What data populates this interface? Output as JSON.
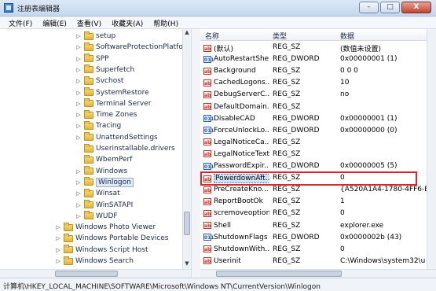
{
  "title": "注册表编辑器",
  "window_buttons": {
    "minimize": "–",
    "maximize": "□",
    "close": "X"
  },
  "menu": [
    "文件(F)",
    "编辑(E)",
    "查看(V)",
    "收藏夹(A)",
    "帮助(H)"
  ],
  "tree": {
    "items": [
      {
        "label": "setup",
        "expander": "▷",
        "indent": 2
      },
      {
        "label": "SoftwareProtectionPlatform",
        "expander": "▷",
        "indent": 2
      },
      {
        "label": "SPP",
        "expander": "▷",
        "indent": 2
      },
      {
        "label": "Superfetch",
        "expander": "▷",
        "indent": 2
      },
      {
        "label": "Svchost",
        "expander": "▷",
        "indent": 2
      },
      {
        "label": "SystemRestore",
        "expander": "▷",
        "indent": 2
      },
      {
        "label": "Terminal Server",
        "expander": "▷",
        "indent": 2
      },
      {
        "label": "Time Zones",
        "expander": "▷",
        "indent": 2
      },
      {
        "label": "Tracing",
        "expander": "▷",
        "indent": 2
      },
      {
        "label": "UnattendSettings",
        "expander": "▷",
        "indent": 2
      },
      {
        "label": "Userinstallable.drivers",
        "expander": "",
        "indent": 2
      },
      {
        "label": "WbemPerf",
        "expander": "",
        "indent": 2
      },
      {
        "label": "Windows",
        "expander": "▷",
        "indent": 2
      },
      {
        "label": "Winlogon",
        "expander": "▷",
        "indent": 2,
        "selected": true
      },
      {
        "label": "Winsat",
        "expander": "▷",
        "indent": 2
      },
      {
        "label": "WinSATAPI",
        "expander": "▷",
        "indent": 2
      },
      {
        "label": "WUDF",
        "expander": "▷",
        "indent": 2
      },
      {
        "label": "Windows Photo Viewer",
        "expander": "▷",
        "indent": 1
      },
      {
        "label": "Windows Portable Devices",
        "expander": "▷",
        "indent": 1
      },
      {
        "label": "Windows Script Host",
        "expander": "▷",
        "indent": 1
      },
      {
        "label": "Windows Search",
        "expander": "▷",
        "indent": 1
      }
    ]
  },
  "values": {
    "headers": {
      "name": "名称",
      "type": "类型",
      "data": "数据"
    },
    "rows": [
      {
        "icon": "sz",
        "name": "(默认)",
        "type": "REG_SZ",
        "data": "(数值未设置)"
      },
      {
        "icon": "dword",
        "name": "AutoRestartShell",
        "type": "REG_DWORD",
        "data": "0x00000001 (1)"
      },
      {
        "icon": "sz",
        "name": "Background",
        "type": "REG_SZ",
        "data": "0 0 0"
      },
      {
        "icon": "sz",
        "name": "CachedLogons...",
        "type": "REG_SZ",
        "data": "10"
      },
      {
        "icon": "sz",
        "name": "DebugServerC...",
        "type": "REG_SZ",
        "data": "no"
      },
      {
        "icon": "sz",
        "name": "DefaultDomain...",
        "type": "REG_SZ",
        "data": ""
      },
      {
        "icon": "dword",
        "name": "DisableCAD",
        "type": "REG_DWORD",
        "data": "0x00000001 (1)"
      },
      {
        "icon": "dword",
        "name": "ForceUnlockLo...",
        "type": "REG_DWORD",
        "data": "0x00000000 (0)"
      },
      {
        "icon": "sz",
        "name": "LegalNoticeCa...",
        "type": "REG_SZ",
        "data": ""
      },
      {
        "icon": "sz",
        "name": "LegalNoticeText",
        "type": "REG_SZ",
        "data": ""
      },
      {
        "icon": "dword",
        "name": "PasswordExpir...",
        "type": "REG_DWORD",
        "data": "0x00000005 (5)"
      },
      {
        "icon": "sz",
        "name": "PowerdownAft...",
        "type": "REG_SZ",
        "data": "0",
        "selected": true
      },
      {
        "icon": "sz",
        "name": "PreCreateKno...",
        "type": "REG_SZ",
        "data": "{A520A1A4-1780-4FF6-E"
      },
      {
        "icon": "sz",
        "name": "ReportBootOk",
        "type": "REG_SZ",
        "data": "1"
      },
      {
        "icon": "sz",
        "name": "scremoveoption",
        "type": "REG_SZ",
        "data": "0"
      },
      {
        "icon": "sz",
        "name": "Shell",
        "type": "REG_SZ",
        "data": "explorer.exe"
      },
      {
        "icon": "dword",
        "name": "ShutdownFlags",
        "type": "REG_DWORD",
        "data": "0x0000002b (43)"
      },
      {
        "icon": "sz",
        "name": "ShutdownWith...",
        "type": "REG_SZ",
        "data": "0"
      },
      {
        "icon": "sz",
        "name": "Userinit",
        "type": "REG_SZ",
        "data": "C:\\Windows\\system32\\u"
      }
    ]
  },
  "icon_labels": {
    "sz": "ab",
    "dword": "011"
  },
  "status": "计算机\\HKEY_LOCAL_MACHINE\\SOFTWARE\\Microsoft\\Windows NT\\CurrentVersion\\Winlogon",
  "colors": {
    "highlight": "#e0242b",
    "selection": "#cfe2f7"
  }
}
